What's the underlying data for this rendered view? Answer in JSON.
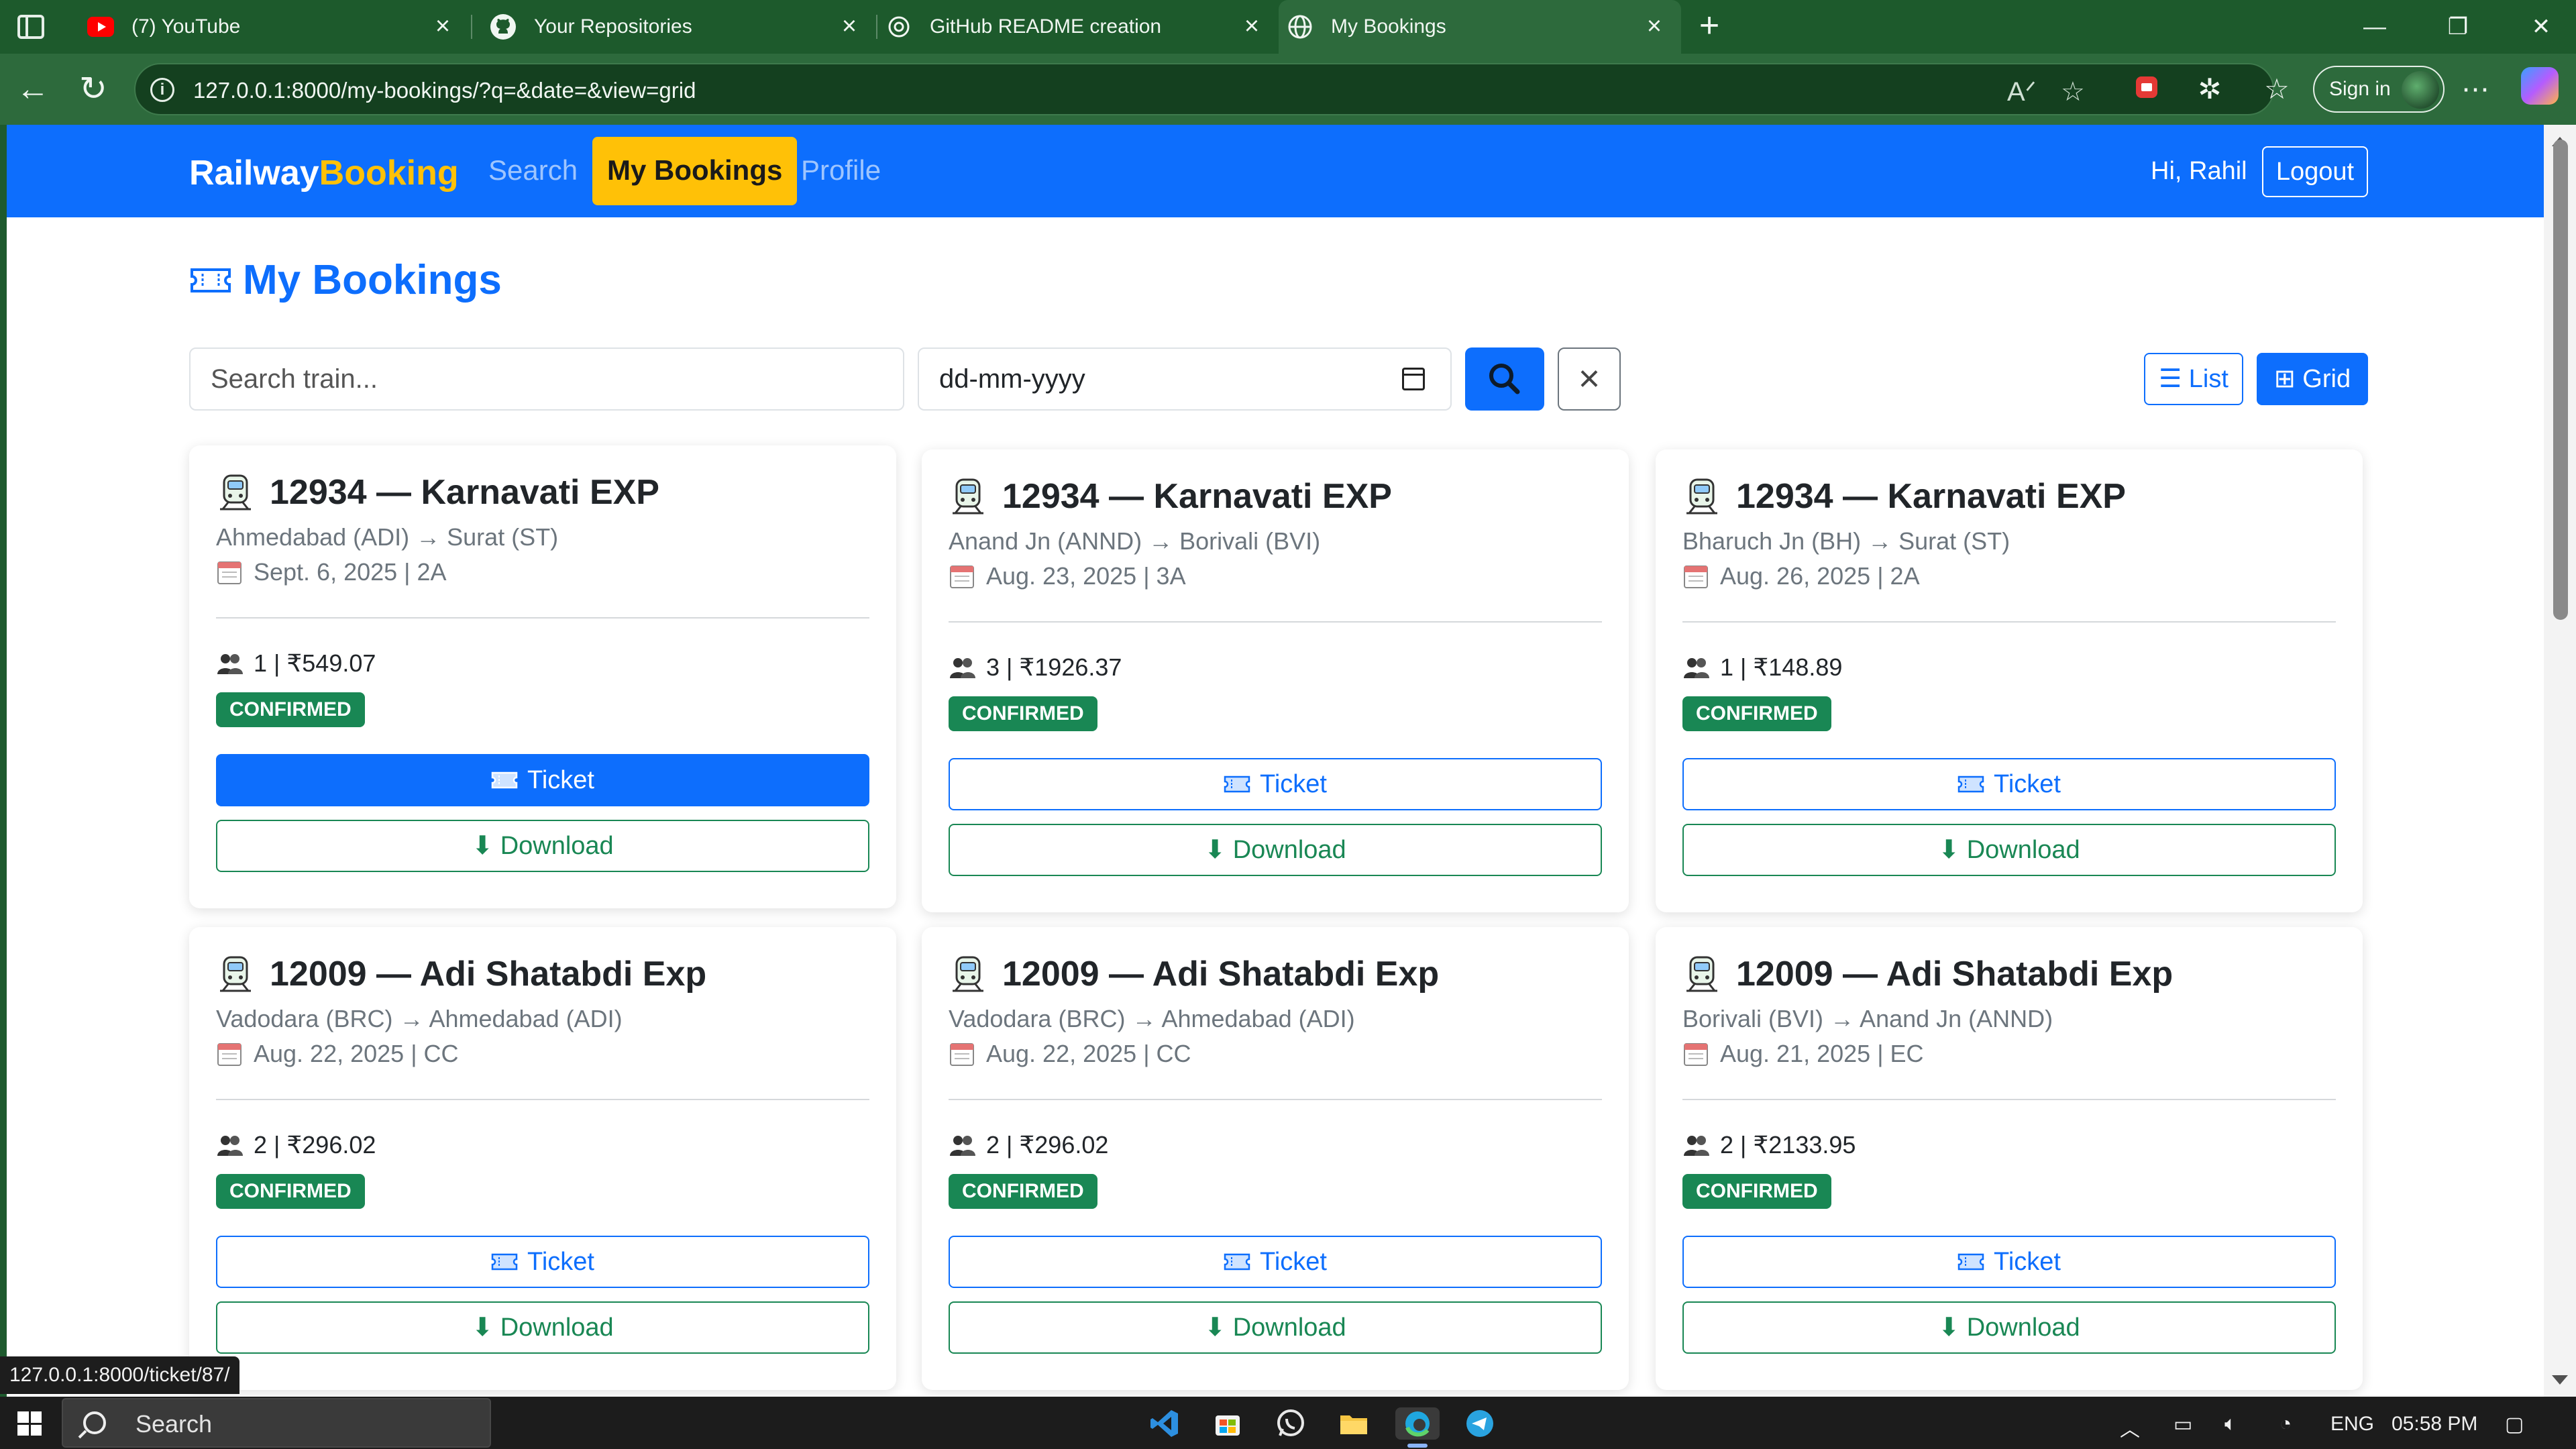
{
  "browser": {
    "tabs": [
      {
        "label": "(7) YouTube",
        "icon": "youtube-icon"
      },
      {
        "label": "Your Repositories",
        "icon": "github-icon"
      },
      {
        "label": "GitHub README creation",
        "icon": "openai-icon"
      },
      {
        "label": "My Bookings",
        "icon": "globe-icon"
      }
    ],
    "url": "127.0.0.1:8000/my-bookings/?q=&date=&view=grid",
    "sign_in_label": "Sign in"
  },
  "navbar": {
    "brand_main": "Railway",
    "brand_accent": "Booking",
    "links": [
      "Search",
      "My Bookings",
      "Profile"
    ],
    "active_link": "My Bookings",
    "greeting": "Hi, Rahil",
    "logout_label": "Logout"
  },
  "page": {
    "title": "My Bookings",
    "search_placeholder": "Search train...",
    "date_placeholder": "dd-mm-yyyy",
    "view_list_label": "List",
    "view_grid_label": "Grid",
    "active_view": "grid"
  },
  "bookings": [
    {
      "train": "12934 — Karnavati EXP",
      "route": "Ahmedabad (ADI) → Surat (ST)",
      "date_class": "Sept. 6, 2025 | 2A",
      "pax_fare": "1 | ₹549.07",
      "status": "CONFIRMED",
      "ticket_label": "Ticket",
      "download_label": "⬇ Download"
    },
    {
      "train": "12934 — Karnavati EXP",
      "route": "Anand Jn (ANND) → Borivali (BVI)",
      "date_class": "Aug. 23, 2025 | 3A",
      "pax_fare": "3 | ₹1926.37",
      "status": "CONFIRMED",
      "ticket_label": "Ticket",
      "download_label": "⬇ Download"
    },
    {
      "train": "12934 — Karnavati EXP",
      "route": "Bharuch Jn (BH) → Surat (ST)",
      "date_class": "Aug. 26, 2025 | 2A",
      "pax_fare": "1 | ₹148.89",
      "status": "CONFIRMED",
      "ticket_label": "Ticket",
      "download_label": "⬇ Download"
    },
    {
      "train": "12009 — Adi Shatabdi Exp",
      "route": "Vadodara (BRC) → Ahmedabad (ADI)",
      "date_class": "Aug. 22, 2025 | CC",
      "pax_fare": "2 | ₹296.02",
      "status": "CONFIRMED",
      "ticket_label": "Ticket",
      "download_label": "⬇ Download"
    },
    {
      "train": "12009 — Adi Shatabdi Exp",
      "route": "Vadodara (BRC) → Ahmedabad (ADI)",
      "date_class": "Aug. 22, 2025 | CC",
      "pax_fare": "2 | ₹296.02",
      "status": "CONFIRMED",
      "ticket_label": "Ticket",
      "download_label": "⬇ Download"
    },
    {
      "train": "12009 — Adi Shatabdi Exp",
      "route": "Borivali (BVI) → Anand Jn (ANND)",
      "date_class": "Aug. 21, 2025 | EC",
      "pax_fare": "2 | ₹2133.95",
      "status": "CONFIRMED",
      "ticket_label": "Ticket",
      "download_label": "⬇ Download"
    }
  ],
  "status_bar_url": "127.0.0.1:8000/ticket/87/",
  "taskbar": {
    "search_label": "Search",
    "language": "ENG",
    "time": "05:58 PM"
  },
  "colors": {
    "primary": "#0d6efd",
    "warning": "#ffc107",
    "success": "#198754",
    "browser_frame": "#1d5a2c"
  }
}
